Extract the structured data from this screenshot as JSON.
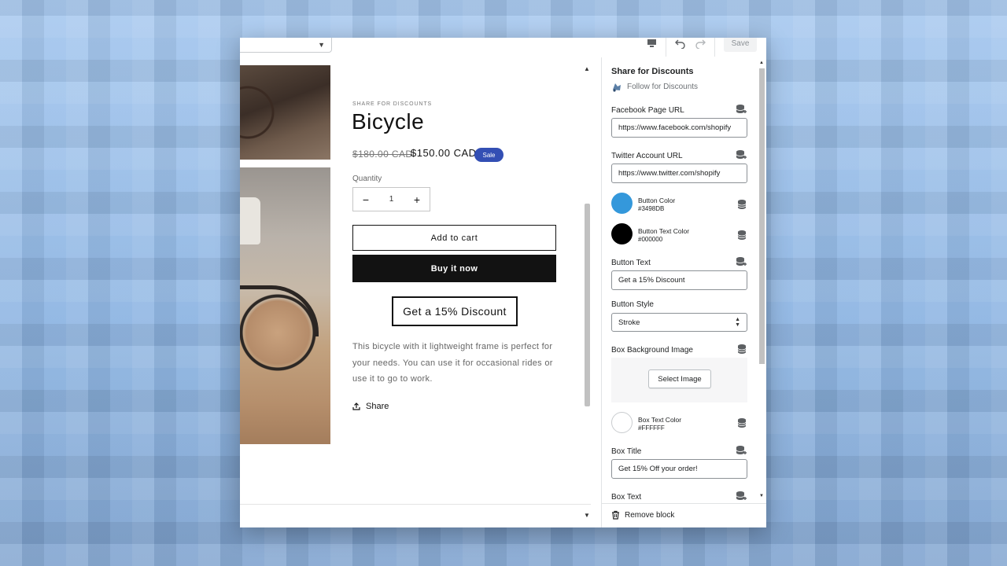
{
  "toolbar": {
    "save_label": "Save"
  },
  "product": {
    "vendor": "SHARE FOR DISCOUNTS",
    "title": "Bicycle",
    "price_old": "$180.00 CAD",
    "price_new": "$150.00 CAD",
    "badge": "Sale",
    "quantity_label": "Quantity",
    "quantity_value": "1",
    "minus": "−",
    "plus": "+",
    "add_to_cart": "Add to cart",
    "buy_now": "Buy it now",
    "discount_button": "Get a 15% Discount",
    "description": "This bicycle with it lightweight frame is perfect for your needs. You can use it for occasional rides or use it to go to work.",
    "share": "Share"
  },
  "panel": {
    "title": "Share for Discounts",
    "subtitle": "Follow for Discounts",
    "facebook_label": "Facebook Page URL",
    "facebook_value": "https://www.facebook.com/shopify",
    "twitter_label": "Twitter Account URL",
    "twitter_value": "https://www.twitter.com/shopify",
    "button_color_label": "Button Color",
    "button_color_hex": "#3498DB",
    "button_text_color_label": "Button Text Color",
    "button_text_color_hex": "#000000",
    "button_text_label": "Button Text",
    "button_text_value": "Get a 15% Discount",
    "button_style_label": "Button Style",
    "button_style_value": "Stroke",
    "box_bg_label": "Box Background Image",
    "select_image": "Select Image",
    "box_text_color_label": "Box Text Color",
    "box_text_color_hex": "#FFFFFF",
    "box_title_label": "Box Title",
    "box_title_value": "Get 15% Off your order!",
    "box_text_label": "Box Text",
    "remove_block": "Remove block"
  },
  "colors": {
    "button_color": "#3498DB",
    "button_text_color": "#000000",
    "box_text_color": "#FFFFFF",
    "sale_badge": "#334FB4",
    "buy_now_bg": "#121212"
  },
  "icons": {
    "toolbar": [
      "desktop-icon",
      "undo-icon",
      "redo-icon"
    ],
    "dynamic_source": "database-icon",
    "share": "share-icon",
    "remove": "trash-icon",
    "app": "app-icon"
  }
}
